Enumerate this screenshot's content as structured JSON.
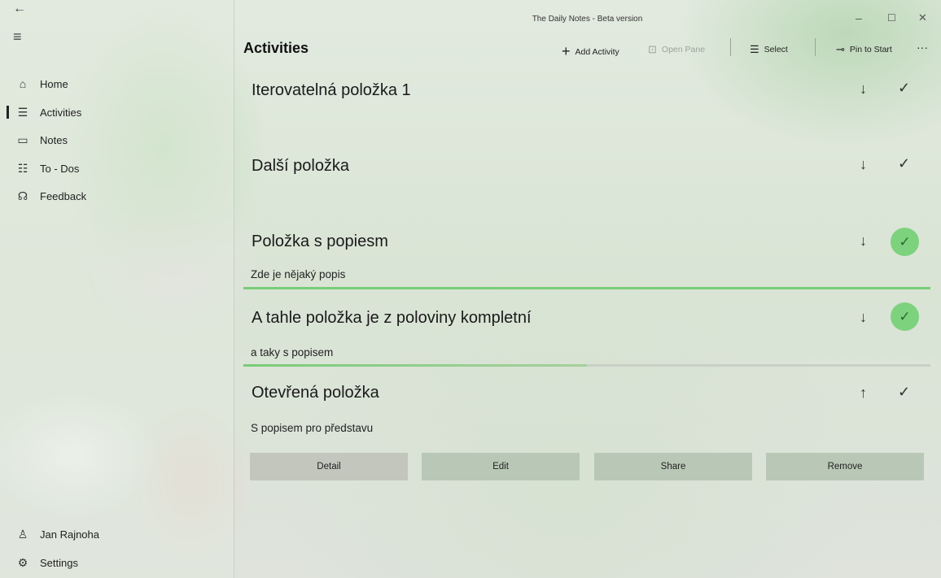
{
  "app": {
    "title": "The Daily Notes - Beta version",
    "window_controls": {
      "minimize": "–",
      "maximize": "☐",
      "close": "✕"
    }
  },
  "sidebar": {
    "back_icon": "←",
    "menu_icon": "≡",
    "items": [
      {
        "label": "Home",
        "icon": "home-icon",
        "glyph": "⌂"
      },
      {
        "label": "Activities",
        "icon": "checklist-icon",
        "glyph": "☰",
        "active": true
      },
      {
        "label": "Notes",
        "icon": "comment-icon",
        "glyph": "▭"
      },
      {
        "label": "To - Dos",
        "icon": "list-icon",
        "glyph": "☷"
      },
      {
        "label": "Feedback",
        "icon": "feedback-icon",
        "glyph": "☊"
      }
    ],
    "footer": [
      {
        "label": "Jan Rajnoha",
        "icon": "person-icon",
        "glyph": "♙"
      },
      {
        "label": "Settings",
        "icon": "gear-icon",
        "glyph": "⚙"
      }
    ]
  },
  "page": {
    "title": "Activities"
  },
  "commands": {
    "add_activity": "Add Activity",
    "open_pane": "Open Pane",
    "select": "Select",
    "pin_to_start": "Pin to Start",
    "more": "···"
  },
  "activities": [
    {
      "title": "Iterovatelná položka 1",
      "description": "",
      "expanded": false,
      "completed": false
    },
    {
      "title": "Další položka",
      "description": "",
      "expanded": false,
      "completed": false
    },
    {
      "title": "Položka s popiesm",
      "description": "Zde je nějaký popis",
      "expanded": false,
      "completed": true,
      "progress": 1.0
    },
    {
      "title": "A tahle položka je z poloviny kompletní",
      "description": "a taky s popisem",
      "expanded": false,
      "completed": true,
      "progress": 0.5
    },
    {
      "title": "Otevřená položka",
      "description": "S popisem pro představu",
      "expanded": true,
      "completed": false
    }
  ],
  "item_actions": {
    "detail": "Detail",
    "edit": "Edit",
    "share": "Share",
    "remove": "Remove"
  },
  "colors": {
    "accent": "#7dd27e",
    "progress": "#79cc78",
    "action_button": "#b9c8b6"
  }
}
